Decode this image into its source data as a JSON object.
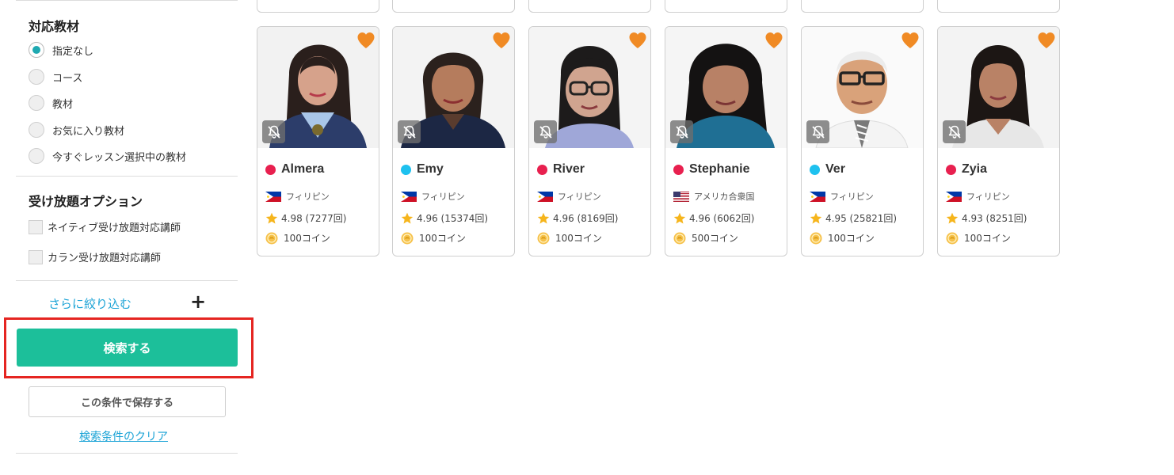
{
  "sidebar": {
    "material_title": "対応教材",
    "material_options": [
      {
        "label": "指定なし",
        "selected": true
      },
      {
        "label": "コース",
        "selected": false
      },
      {
        "label": "教材",
        "selected": false
      },
      {
        "label": "お気に入り教材",
        "selected": false
      },
      {
        "label": "今すぐレッスン選択中の教材",
        "selected": false
      }
    ],
    "unlimited_title": "受け放題オプション",
    "unlimited_options": [
      {
        "label": "ネイティブ受け放題対応講師",
        "checked": false
      },
      {
        "label": "カラン受け放題対応講師",
        "checked": false
      }
    ],
    "more_filters_label": "さらに絞り込む",
    "more_filters_icon": "+",
    "search_button_label": "検索する",
    "save_button_label": "この条件で保存する",
    "clear_link_label": "検索条件のクリア"
  },
  "colors": {
    "accent_green": "#1cbf9a",
    "link_blue": "#1ba3d6",
    "radio_teal": "#1fa9b1",
    "heart_orange": "#f08a24",
    "highlight_red": "#e52521",
    "status_red": "#e8204f",
    "status_blue": "#1ec1ef"
  },
  "tutors": [
    {
      "name": "Almera",
      "status": "red",
      "country": "フィリピン",
      "flag": "ph-flag",
      "rating": "4.98",
      "reviews": "(7277回)",
      "price": "100コイン"
    },
    {
      "name": "Emy",
      "status": "blue",
      "country": "フィリピン",
      "flag": "ph-flag",
      "rating": "4.96",
      "reviews": "(15374回)",
      "price": "100コイン"
    },
    {
      "name": "River",
      "status": "red",
      "country": "フィリピン",
      "flag": "ph-flag",
      "rating": "4.96",
      "reviews": "(8169回)",
      "price": "100コイン"
    },
    {
      "name": "Stephanie",
      "status": "red",
      "country": "アメリカ合衆国",
      "flag": "us-flag",
      "rating": "4.96",
      "reviews": "(6062回)",
      "price": "500コイン"
    },
    {
      "name": "Ver",
      "status": "blue",
      "country": "フィリピン",
      "flag": "ph-flag",
      "rating": "4.95",
      "reviews": "(25821回)",
      "price": "100コイン"
    },
    {
      "name": "Zyia",
      "status": "red",
      "country": "フィリピン",
      "flag": "ph-flag",
      "rating": "4.93",
      "reviews": "(8251回)",
      "price": "100コイン"
    }
  ]
}
